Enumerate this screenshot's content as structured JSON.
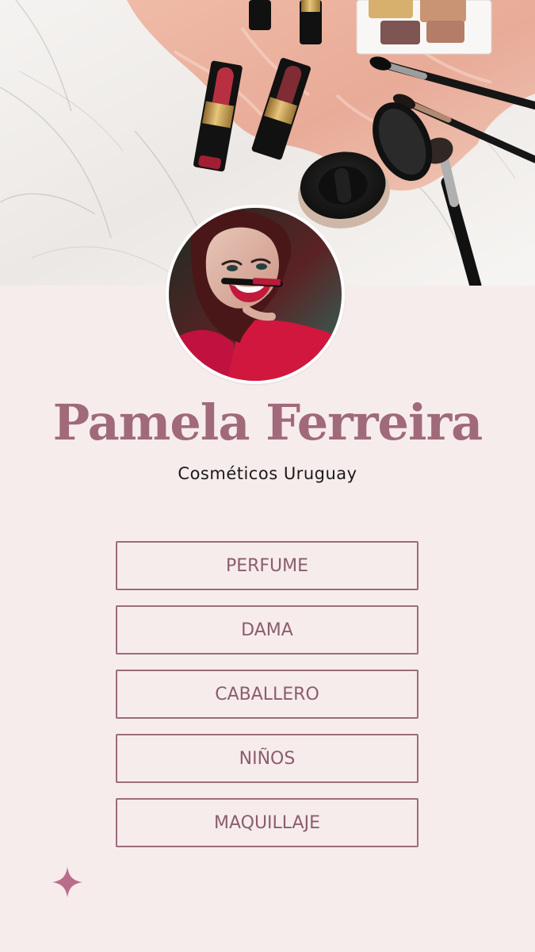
{
  "profile": {
    "name": "Pamela Ferreira",
    "tagline": "Cosméticos Uruguay"
  },
  "links": [
    {
      "label": "PERFUME"
    },
    {
      "label": "DAMA"
    },
    {
      "label": "CABALLERO"
    },
    {
      "label": "NIÑOS"
    },
    {
      "label": "MAQUILLAJE"
    }
  ],
  "colors": {
    "background": "#f7ecec",
    "accent": "#a06a7b",
    "button_border": "#9a6d7d",
    "button_text": "#8b5d6f"
  },
  "icons": {
    "decoration": "sparkle-icon"
  }
}
